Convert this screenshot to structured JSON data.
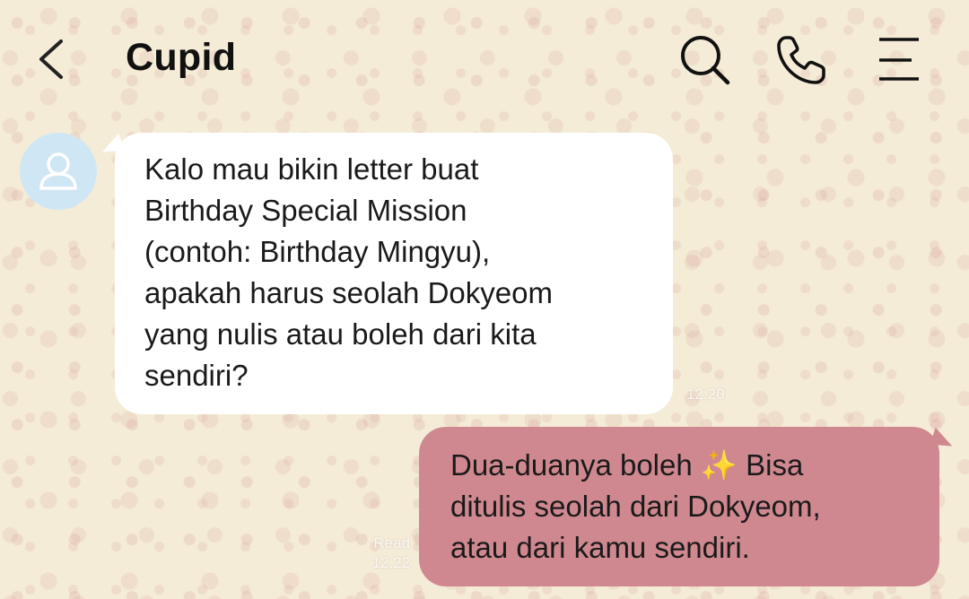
{
  "header": {
    "title": "Cupid",
    "back_icon": "chevron-left-icon",
    "search_icon": "search-icon",
    "call_icon": "phone-icon",
    "menu_icon": "menu-icon"
  },
  "messages": [
    {
      "direction": "incoming",
      "text": "Kalo mau bikin letter buat\nBirthday Special Mission\n(contoh: Birthday Mingyu),\napakah harus seolah Dokyeom\nyang nulis atau boleh dari kita\nsendiri?",
      "time": "12.20"
    },
    {
      "direction": "outgoing",
      "text": "Dua-duanya boleh ✨ Bisa\nditulis seolah dari Dokyeom,\natau dari kamu sendiri.",
      "status": "Read",
      "time": "12.22"
    }
  ],
  "colors": {
    "background": "#f4ecd6",
    "incoming_bubble": "#ffffff",
    "outgoing_bubble": "#d08890",
    "avatar_bg": "#cfe7f5"
  }
}
